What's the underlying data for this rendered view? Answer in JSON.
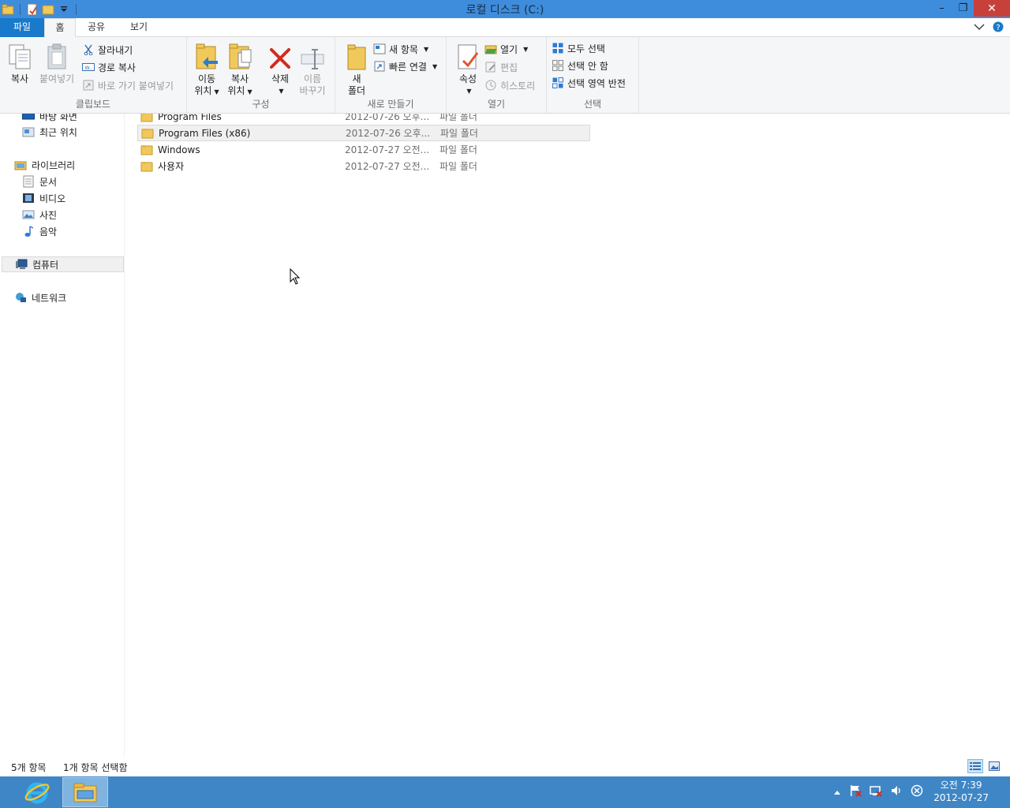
{
  "window": {
    "title": "로컬 디스크 (C:)",
    "minimize": "–",
    "restore": "❐",
    "close": "✕"
  },
  "tabs": {
    "file": "파일",
    "home": "홈",
    "share": "공유",
    "view": "보기"
  },
  "ribbon": {
    "clipboard": {
      "label": "클립보드",
      "copy": "복사",
      "paste": "붙여넣기",
      "cut": "잘라내기",
      "copy_path": "경로 복사",
      "paste_shortcut": "바로 가기 붙여넣기"
    },
    "organize": {
      "label": "구성",
      "move_to_1": "이동",
      "move_to_2": "위치",
      "copy_to_1": "복사",
      "copy_to_2": "위치",
      "delete": "삭제",
      "rename_1": "이름",
      "rename_2": "바꾸기"
    },
    "new": {
      "label": "새로 만들기",
      "new_folder_1": "새",
      "new_folder_2": "폴더",
      "new_item": "새 항목",
      "easy_access": "빠른 연결"
    },
    "open": {
      "label": "열기",
      "properties": "속성",
      "open": "열기",
      "edit": "편집",
      "history": "히스토리"
    },
    "select": {
      "label": "선택",
      "select_all": "모두 선택",
      "select_none": "선택 안 함",
      "invert": "선택 영역 반전"
    }
  },
  "nav": {
    "desktop_partial": "바탕 화면",
    "recent": "최근 위치",
    "libraries": "라이브러리",
    "documents": "문서",
    "videos": "비디오",
    "pictures": "사진",
    "music": "음악",
    "computer": "컴퓨터",
    "network": "네트워크"
  },
  "files": [
    {
      "name": "Program Files",
      "date": "2012-07-26 오후...",
      "type": "파일 폴더"
    },
    {
      "name": "Program Files (x86)",
      "date": "2012-07-26 오후...",
      "type": "파일 폴더"
    },
    {
      "name": "Windows",
      "date": "2012-07-27 오전...",
      "type": "파일 폴더"
    },
    {
      "name": "사용자",
      "date": "2012-07-27 오전...",
      "type": "파일 폴더"
    }
  ],
  "status": {
    "count": "5개 항목",
    "selected": "1개 항목 선택함"
  },
  "clock": {
    "time": "오전 7:39",
    "date": "2012-07-27"
  },
  "colors": {
    "titlebar": "#3e8ddd",
    "file_tab": "#1979ca",
    "taskbar": "#3f86c6",
    "close": "#c7413a"
  }
}
